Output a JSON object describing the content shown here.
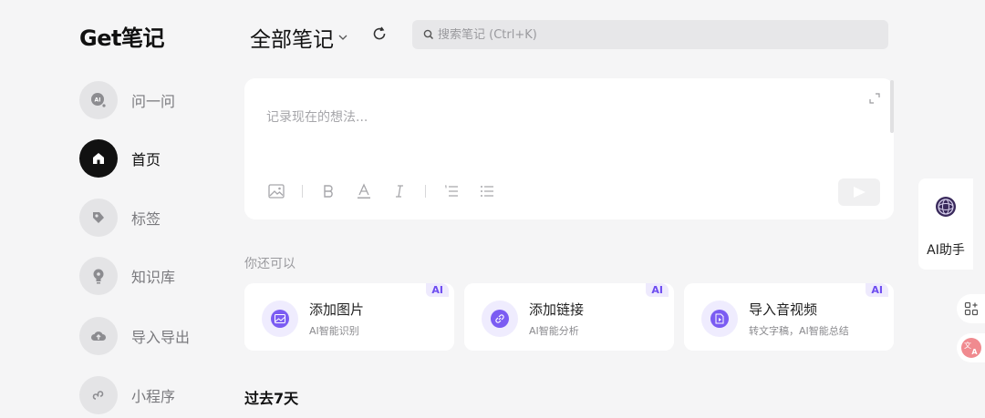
{
  "app": {
    "logo_prefix": "Get",
    "logo_suffix": "笔记"
  },
  "sidebar": {
    "items": [
      {
        "label": "问一问",
        "icon": "ai-chat-icon",
        "active": false
      },
      {
        "label": "首页",
        "icon": "home-icon",
        "active": true
      },
      {
        "label": "标签",
        "icon": "tag-icon",
        "active": false
      },
      {
        "label": "知识库",
        "icon": "lightbulb-icon",
        "active": false
      },
      {
        "label": "导入导出",
        "icon": "cloud-upload-icon",
        "active": false
      },
      {
        "label": "小程序",
        "icon": "miniprogram-icon",
        "active": false
      }
    ]
  },
  "header": {
    "title": "全部笔记",
    "search_placeholder": "搜索笔记 (Ctrl+K)"
  },
  "editor": {
    "placeholder": "记录现在的想法..."
  },
  "suggestions": {
    "label": "你还可以",
    "cards": [
      {
        "title": "添加图片",
        "subtitle": "AI智能识别",
        "badge": "AI",
        "icon": "image-icon"
      },
      {
        "title": "添加链接",
        "subtitle": "AI智能分析",
        "badge": "AI",
        "icon": "link-icon"
      },
      {
        "title": "导入音视频",
        "subtitle": "转文字稿，AI智能总结",
        "badge": "AI",
        "icon": "file-audio-icon"
      }
    ]
  },
  "recent": {
    "label": "过去7天"
  },
  "ai_assistant": {
    "label": "AI助手"
  },
  "colors": {
    "accent": "#7b5cf2",
    "background": "#f5f5f6",
    "active_nav": "#111111"
  }
}
